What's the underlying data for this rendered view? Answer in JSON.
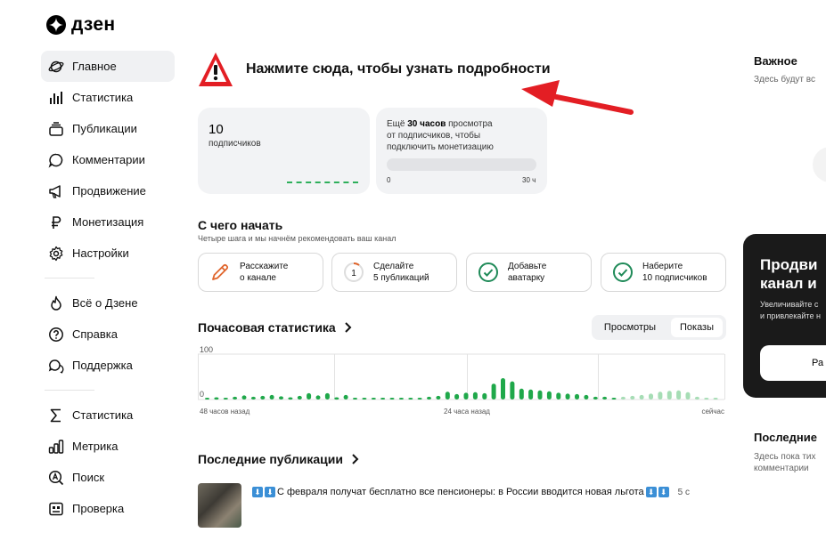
{
  "brand": {
    "name": "дзен"
  },
  "sidebar": {
    "items": [
      {
        "label": "Главное",
        "icon": "planet-icon",
        "active": true
      },
      {
        "label": "Статистика",
        "icon": "bar-chart-icon"
      },
      {
        "label": "Публикации",
        "icon": "stack-icon"
      },
      {
        "label": "Комментарии",
        "icon": "comment-icon"
      },
      {
        "label": "Продвижение",
        "icon": "megaphone-icon"
      },
      {
        "label": "Монетизация",
        "icon": "ruble-icon"
      },
      {
        "label": "Настройки",
        "icon": "gear-icon"
      }
    ],
    "help": [
      {
        "label": "Всё о Дзене",
        "icon": "flame-icon"
      },
      {
        "label": "Справка",
        "icon": "question-icon"
      },
      {
        "label": "Поддержка",
        "icon": "chat-icon"
      }
    ],
    "tools": [
      {
        "label": "Статистика",
        "icon": "sigma-icon"
      },
      {
        "label": "Метрика",
        "icon": "metrics-icon"
      },
      {
        "label": "Поиск",
        "icon": "search-a-icon"
      },
      {
        "label": "Проверка",
        "icon": "check-card-icon"
      }
    ]
  },
  "alert": {
    "text": "Нажмите сюда, чтобы узнать подробности"
  },
  "subscribers": {
    "count": "10",
    "label": "подписчиков"
  },
  "monetization": {
    "line1_pre": "Ещё ",
    "line1_bold": "30 часов",
    "line1_post": " просмотра",
    "line2": "от подписчиков, чтобы",
    "line3": "подключить монетизацию",
    "progress": 0,
    "min_label": "0",
    "max_label": "30 ч"
  },
  "start": {
    "title": "С чего начать",
    "subtitle": "Четыре шага и мы начнём рекомендовать ваш канал",
    "steps": [
      {
        "line1": "Расскажите",
        "line2": "о канале",
        "icon": "pencil-icon"
      },
      {
        "line1": "Сделайте",
        "line2": "5 публикаций",
        "icon": "progress-ring-icon",
        "badge": "1"
      },
      {
        "line1": "Добавьте",
        "line2": "аватарку",
        "icon": "check-circle-icon"
      },
      {
        "line1": "Наберите",
        "line2": "10 подписчиков",
        "icon": "check-circle-icon"
      }
    ]
  },
  "hourly": {
    "title": "Почасовая статистика",
    "tabs": [
      {
        "label": "Просмотры",
        "selected": false
      },
      {
        "label": "Показы",
        "selected": true
      }
    ],
    "y_max_label": "100",
    "y_min_label": "0",
    "x_labels": [
      "48 часов назад",
      "24 часа назад",
      "сейчас"
    ]
  },
  "chart_data": {
    "type": "bar",
    "ylim": [
      0,
      100
    ],
    "series": [
      {
        "values": [
          4,
          5,
          4,
          6,
          9,
          6,
          8,
          10,
          7,
          5,
          8,
          14,
          9,
          14,
          5,
          10,
          3,
          3,
          3,
          3,
          3,
          3,
          3,
          4,
          6,
          8,
          17,
          12,
          15,
          16,
          14,
          35,
          47,
          40,
          24,
          22,
          20,
          18,
          15,
          13,
          12,
          10,
          6,
          6,
          4,
          6,
          8,
          10,
          13,
          17,
          19,
          20,
          16,
          6,
          3,
          4
        ]
      }
    ],
    "faded_from_index": 45,
    "color": "#1fa84a",
    "faded_color": "#a6ddb5",
    "grid": true
  },
  "recent": {
    "title": "Последние публикации",
    "items": [
      {
        "title": "С февраля получат бесплатно все пенсионеры: в России вводится новая льгота",
        "time": "5 с"
      }
    ]
  },
  "right": {
    "important_title": "Важное",
    "important_sub": "Здесь будут вс",
    "promo_line1": "Продви",
    "promo_line2": "канал и",
    "promo_sub1": "Увеличивайте с",
    "promo_sub2": "и привлекайте н",
    "promo_button": "Ра",
    "last_title": "Последние",
    "last_sub1": "Здесь пока тих",
    "last_sub2": "комментарии"
  }
}
